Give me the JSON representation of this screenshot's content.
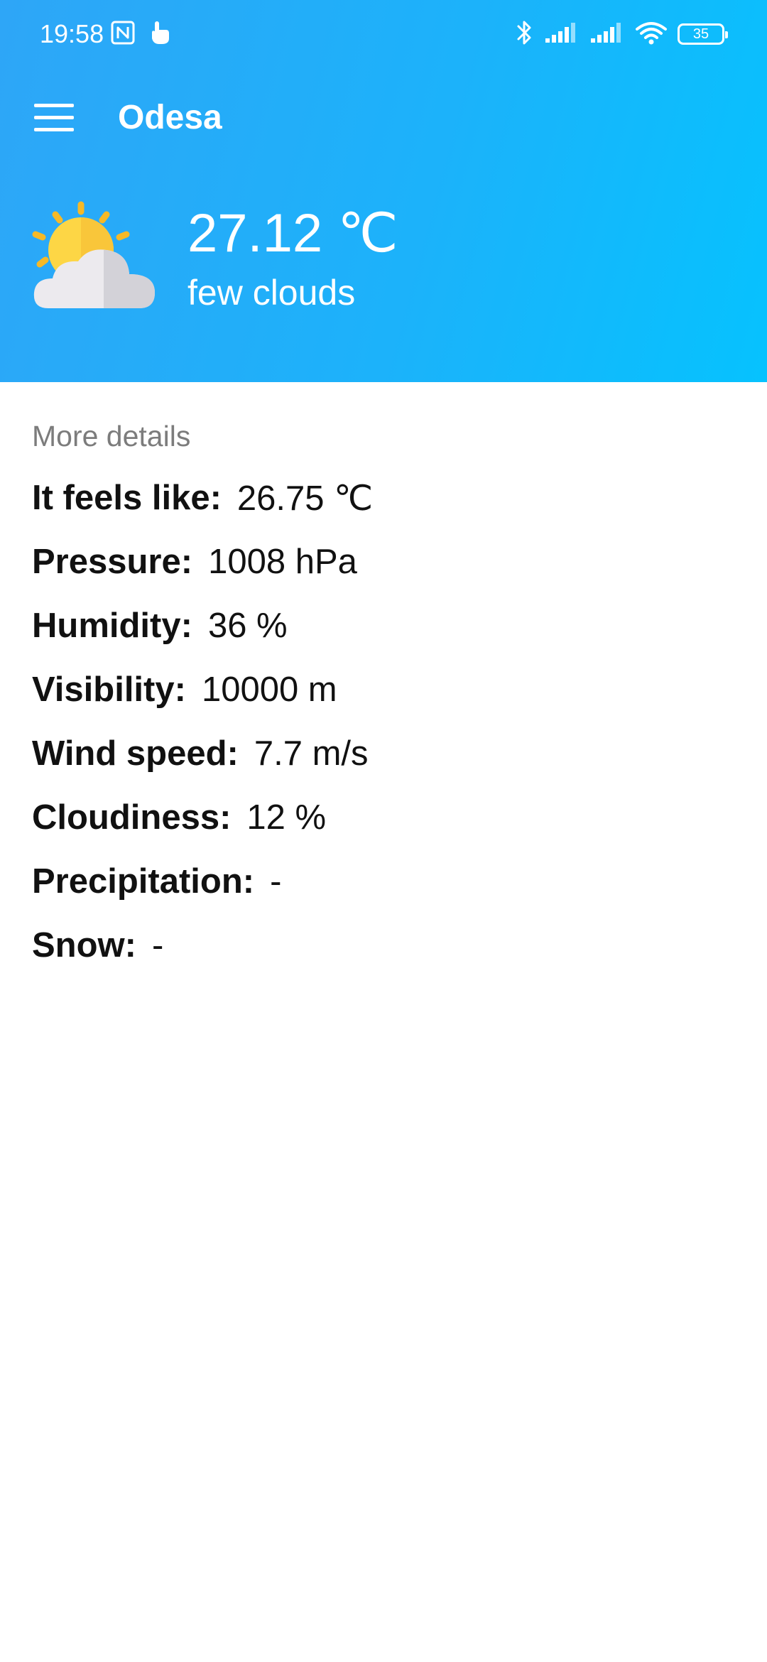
{
  "status_bar": {
    "time": "19:58",
    "battery": "35",
    "left_icons": [
      "nfc-icon",
      "touch-gesture-icon"
    ],
    "right_icons": [
      "bluetooth-icon",
      "signal-icon",
      "signal-icon",
      "wifi-icon",
      "battery-icon"
    ]
  },
  "toolbar": {
    "menu_icon": "menu-icon",
    "title": "Odesa"
  },
  "current": {
    "icon": "partly-cloudy-icon",
    "temperature": "27.12 ℃",
    "description": "few clouds"
  },
  "details": {
    "heading": "More details",
    "rows": [
      {
        "label": "It feels like:",
        "value": "26.75 ℃"
      },
      {
        "label": "Pressure:",
        "value": "1008 hPa"
      },
      {
        "label": "Humidity:",
        "value": "36 %"
      },
      {
        "label": "Visibility:",
        "value": "10000 m"
      },
      {
        "label": "Wind speed:",
        "value": "7.7 m/s"
      },
      {
        "label": "Cloudiness:",
        "value": "12 %"
      },
      {
        "label": "Precipitation:",
        "value": "-"
      },
      {
        "label": "Snow:",
        "value": "-"
      }
    ]
  },
  "colors": {
    "header_start": "#2ea6f7",
    "header_end": "#06c2fe",
    "heading_gray": "#7c7c7c",
    "text": "#111111",
    "sun_yellow": "#fdd645",
    "sun_ray": "#f6b927",
    "cloud_light": "#eceaee",
    "cloud_shade": "#d3d2d8"
  }
}
